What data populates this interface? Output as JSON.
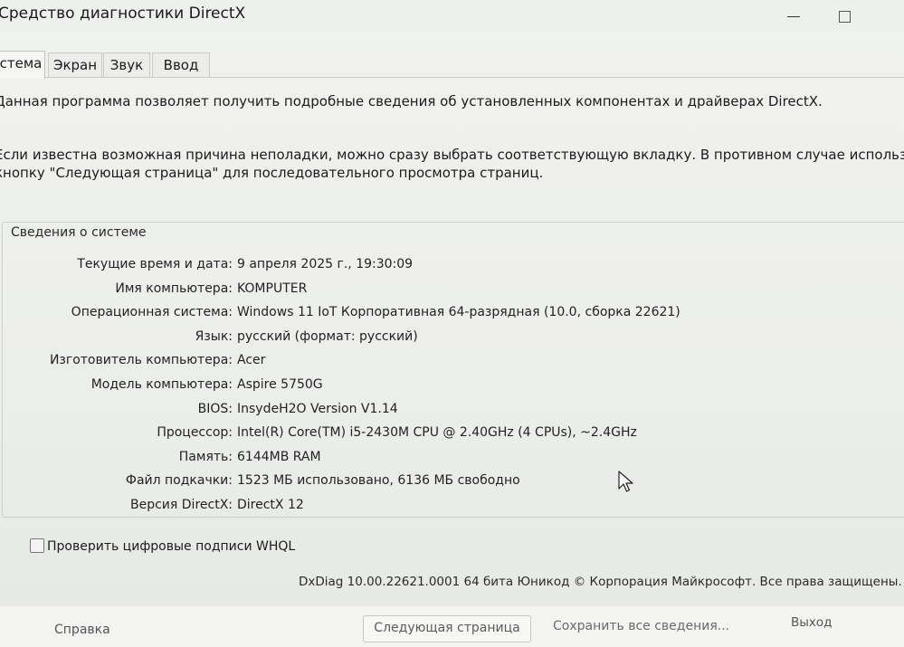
{
  "window": {
    "title": "Средство диагностики DirectX"
  },
  "tabs": [
    {
      "label": "стема",
      "active": true
    },
    {
      "label": "Экран",
      "active": false
    },
    {
      "label": "Звук",
      "active": false
    },
    {
      "label": "Ввод",
      "active": false
    }
  ],
  "intro": {
    "line1": "Данная программа позволяет получить подробные сведения об установленных компонентах и драйверах DirectX.",
    "line2a": "Если известна возможная причина неполадки, можно сразу выбрать соответствующую вкладку. В противном случае используйте",
    "line2b": "кнопку \"Следующая страница\" для последовательного просмотра страниц."
  },
  "system_info": {
    "title": "Сведения о системе",
    "rows": [
      {
        "label": "Текущие время и дата:",
        "value": "9 апреля 2025 г., 19:30:09"
      },
      {
        "label": "Имя компьютера:",
        "value": "KOMPUTER"
      },
      {
        "label": "Операционная система:",
        "value": "Windows 11 IoT Корпоративная 64-разрядная (10.0, сборка 22621)"
      },
      {
        "label": "Язык:",
        "value": "русский (формат: русский)"
      },
      {
        "label": "Изготовитель компьютера:",
        "value": "Acer"
      },
      {
        "label": "Модель компьютера:",
        "value": "Aspire 5750G"
      },
      {
        "label": "BIOS:",
        "value": "InsydeH2O Version V1.14"
      },
      {
        "label": "Процессор:",
        "value": "Intel(R) Core(TM) i5-2430M CPU @ 2.40GHz (4 CPUs), ~2.4GHz"
      },
      {
        "label": "Память:",
        "value": "6144MB RAM"
      },
      {
        "label": "Файл подкачки:",
        "value": "1523 МБ использовано, 6136 МБ свободно"
      },
      {
        "label": "Версия DirectX:",
        "value": "DirectX 12"
      }
    ]
  },
  "whql": {
    "label": "Проверить цифровые подписи WHQL",
    "checked": false
  },
  "footer": {
    "copyright": "DxDiag 10.00.22621.0001 64 бита Юникод © Корпорация Майкрософт. Все права защищены.",
    "help": "Справка",
    "next": "Следующая страница",
    "save": "Сохранить все сведения...",
    "exit": "Выход"
  }
}
